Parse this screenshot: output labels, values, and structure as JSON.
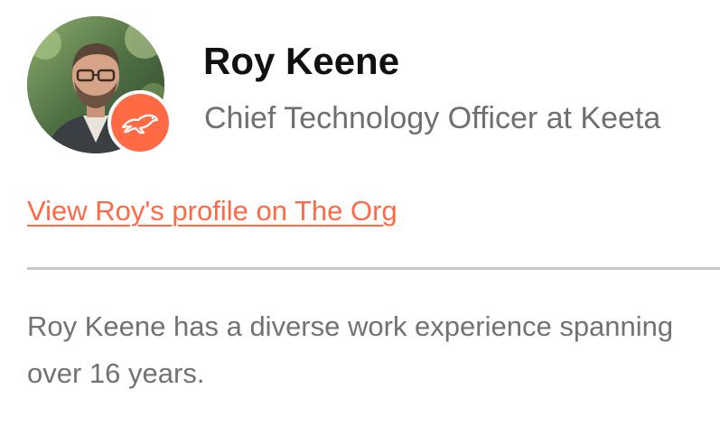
{
  "profile": {
    "name": "Roy Keene",
    "title": "Chief Technology Officer at Keeta",
    "link_text": "View Roy's profile on The Org",
    "bio": "Roy Keene has a diverse work experience spanning over 16 years.",
    "avatar_icon": "person-photo",
    "badge_icon": "cheetah-logo-icon"
  },
  "colors": {
    "accent": "#ff6a45",
    "name": "#111111",
    "muted": "#6f6f6f",
    "divider": "#c8c8c8"
  }
}
